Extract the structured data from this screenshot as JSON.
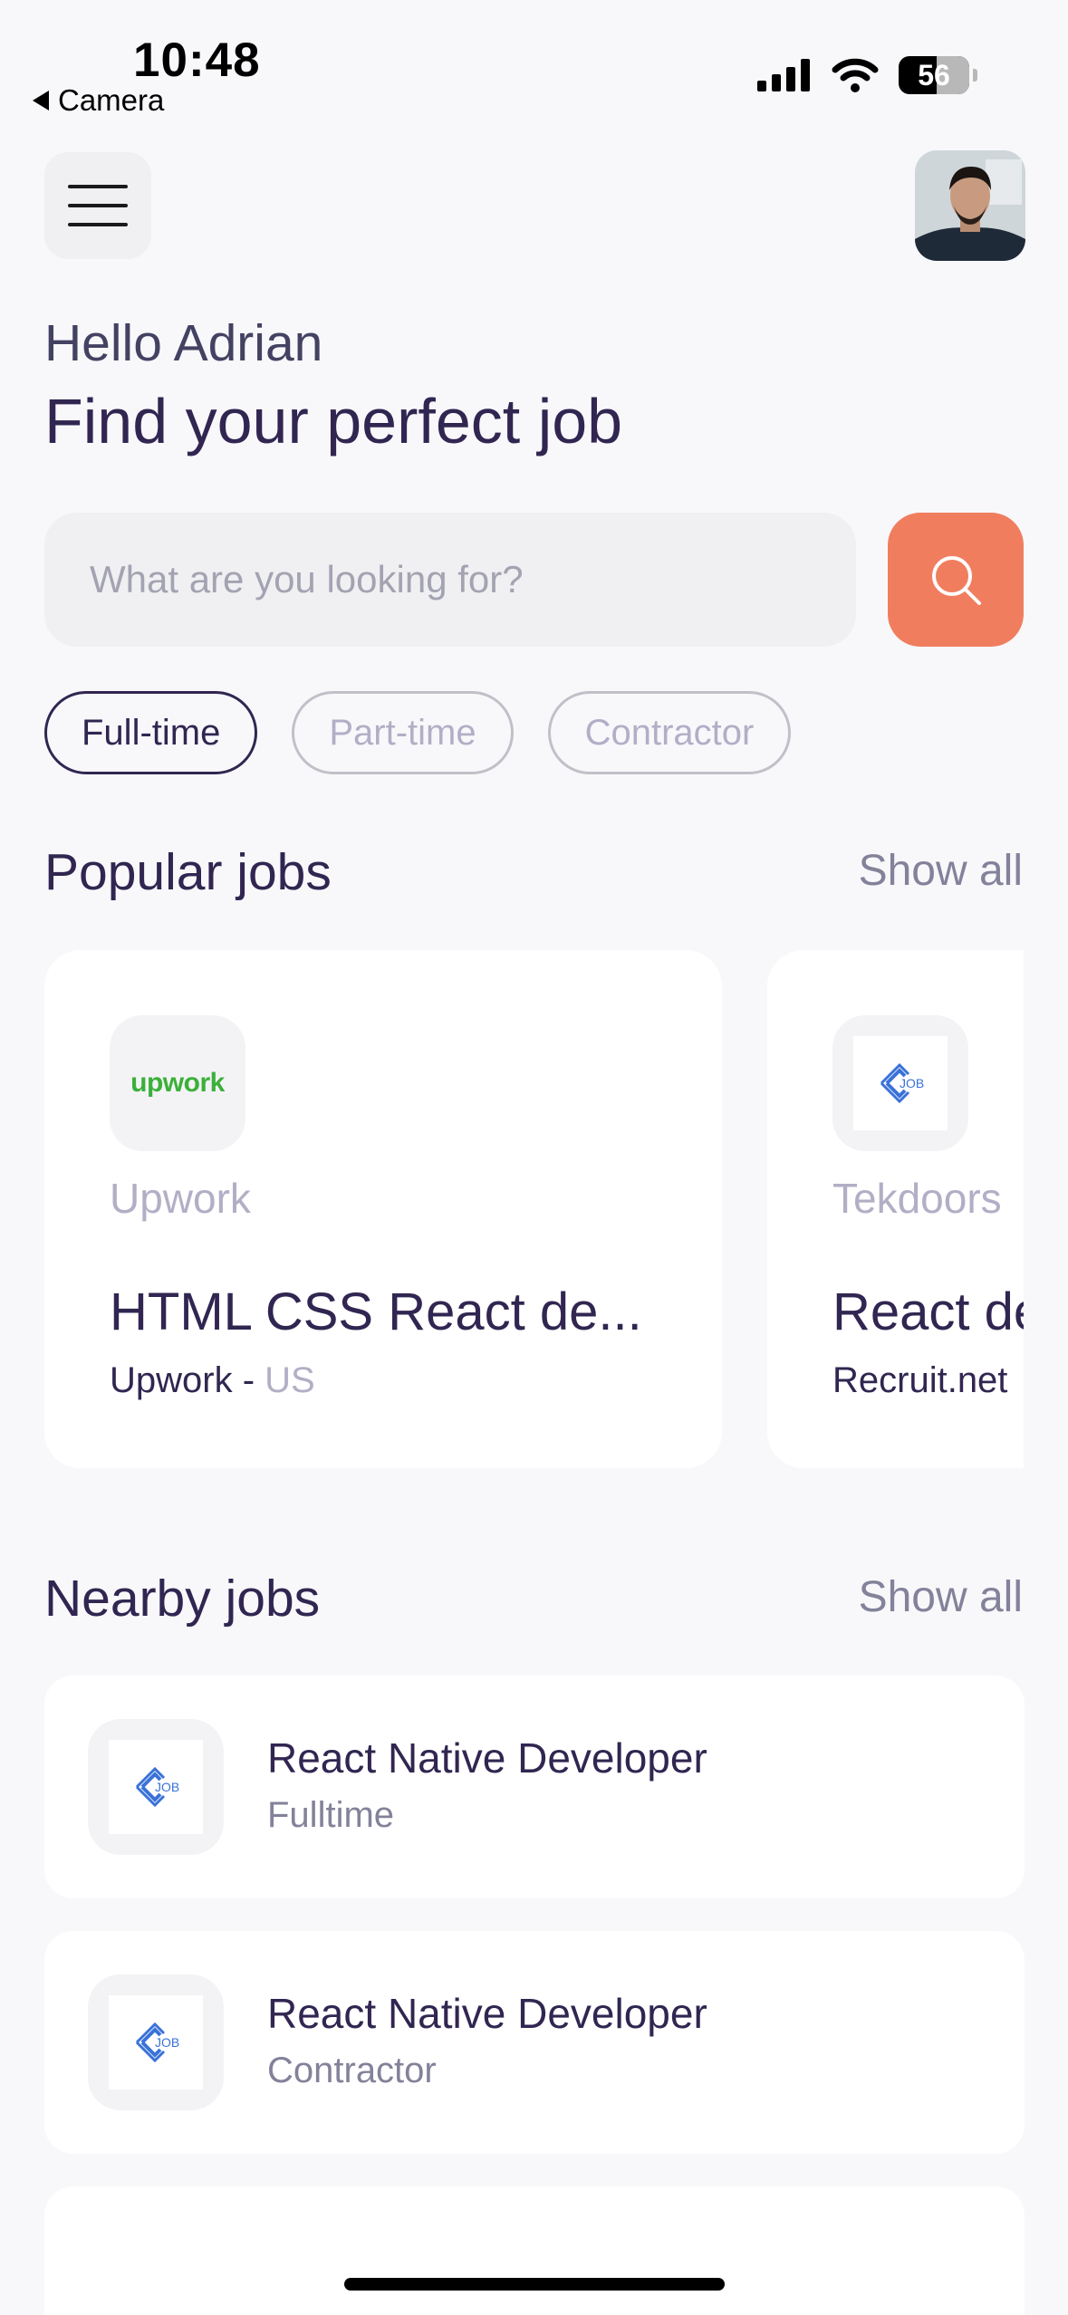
{
  "status_bar": {
    "time": "10:48",
    "back_label": "Camera",
    "battery": "56"
  },
  "header": {
    "greeting": "Hello Adrian",
    "headline": "Find your perfect job"
  },
  "search": {
    "placeholder": "What are you looking for?",
    "value": ""
  },
  "job_types": [
    {
      "label": "Full-time",
      "active": true
    },
    {
      "label": "Part-time",
      "active": false
    },
    {
      "label": "Contractor",
      "active": false
    }
  ],
  "popular": {
    "title": "Popular jobs",
    "show_all": "Show all",
    "jobs": [
      {
        "company": "Upwork",
        "logo_text": "upwork",
        "title": "HTML CSS React de...",
        "publisher": "Upwork - ",
        "country": "US"
      },
      {
        "company": "Tekdoors",
        "logo_text": "JOB",
        "title": "React de",
        "publisher": "Recruit.net",
        "country": ""
      }
    ]
  },
  "nearby": {
    "title": "Nearby jobs",
    "show_all": "Show all",
    "jobs": [
      {
        "title": "React Native Developer",
        "type": "Fulltime",
        "logo_text": "JOB"
      },
      {
        "title": "React Native Developer",
        "type": "Contractor",
        "logo_text": "JOB"
      }
    ]
  },
  "colors": {
    "primary": "#312651",
    "accent": "#f07e5e",
    "muted": "#b3aec6",
    "background": "#f8f8fb"
  }
}
